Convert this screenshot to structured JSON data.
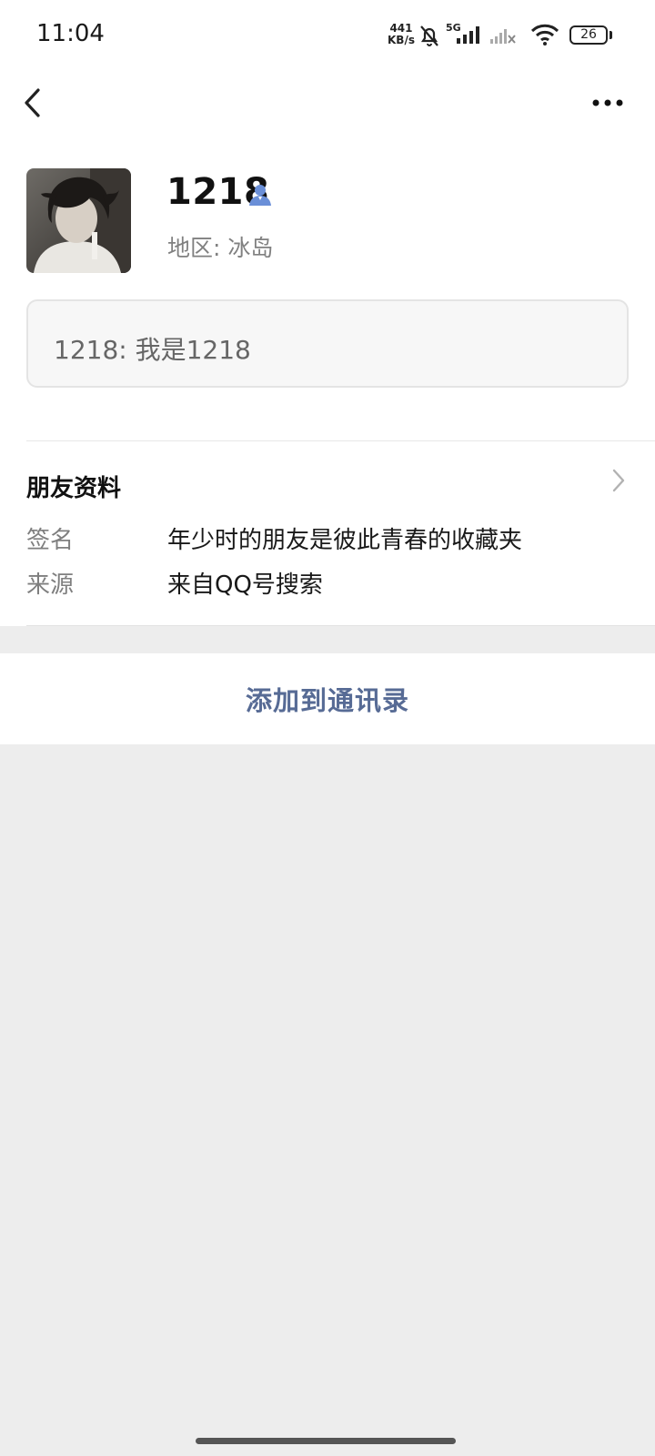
{
  "status_bar": {
    "time": "11:04",
    "net_speed_value": "441",
    "net_speed_unit": "KB/s",
    "network_type": "5G",
    "battery": "26"
  },
  "nav": {
    "back_icon": "chevron-left-icon",
    "more_icon": "more-dots-icon"
  },
  "profile": {
    "nickname": "1218",
    "region_label": "地区:",
    "region_value": "冰岛",
    "verified_icon": "user-icon",
    "accent": "#6a8fd8"
  },
  "greeting": "1218: 我是1218",
  "friend_info": {
    "title": "朋友资料",
    "rows": [
      {
        "label": "签名",
        "value": "年少时的朋友是彼此青春的收藏夹"
      },
      {
        "label": "来源",
        "value": "来自QQ号搜索"
      }
    ]
  },
  "actions": {
    "add_contact": "添加到通讯录",
    "link_color": "#576b95"
  }
}
